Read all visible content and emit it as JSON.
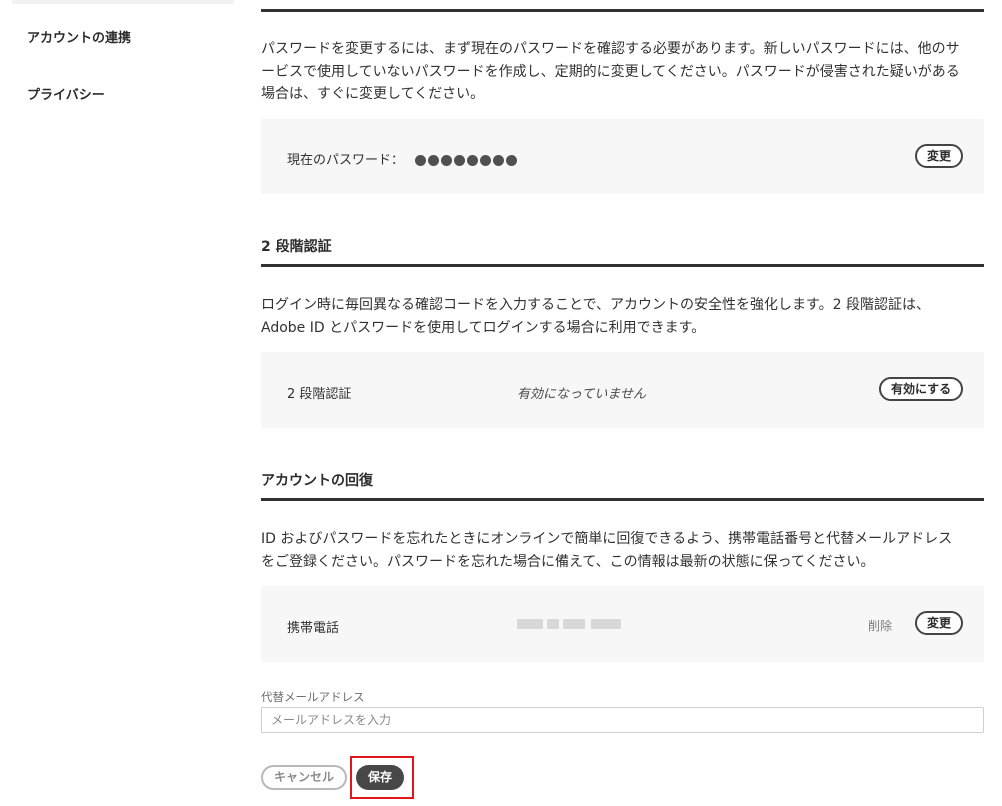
{
  "sidebar": {
    "items": [
      {
        "label": "アカウントの連携"
      },
      {
        "label": "プライバシー"
      }
    ]
  },
  "password": {
    "description_lines": [
      "パスワードを変更するには、まず現在のパスワードを確認する必要があります。新しいパスワードには、他のサ",
      "ービスで使用していないパスワードを作成し、定期的に変更してください。パスワードが侵害された疑いがある",
      "場合は、すぐに変更してください。"
    ],
    "current_label": "現在のパスワード：",
    "change_button": "変更"
  },
  "two_step": {
    "title": "2 段階認証",
    "description_lines": [
      "ログイン時に毎回異なる確認コードを入力することで、アカウントの安全性を強化します。2 段階認証は、",
      "Adobe ID とパスワードを使用してログインする場合に利用できます。"
    ],
    "row_label": "2 段階認証",
    "status": "有効になっていません",
    "enable_button": "有効にする"
  },
  "recovery": {
    "title": "アカウントの回復",
    "description_lines": [
      "ID およびパスワードを忘れたときにオンラインで簡単に回復できるよう、携帯電話番号と代替メールアドレス",
      "をご登録ください。パスワードを忘れた場合に備えて、この情報は最新の状態に保ってください。"
    ],
    "phone_label": "携帯電話",
    "delete_label": "削除",
    "change_button": "変更",
    "alt_email_label": "代替メールアドレス",
    "alt_email_placeholder": "メールアドレスを入力"
  },
  "actions": {
    "cancel": "キャンセル",
    "save": "保存"
  },
  "colors": {
    "highlight": "#e0161b",
    "save_bg": "#474747",
    "card_bg": "#f7f7f7"
  }
}
